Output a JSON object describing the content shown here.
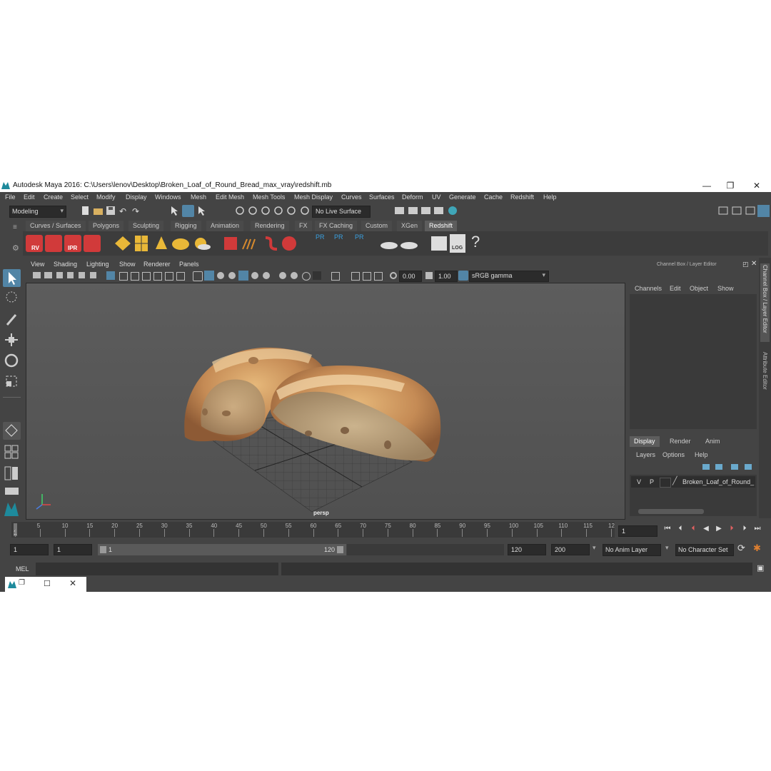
{
  "window": {
    "title": "Autodesk Maya 2016: C:\\Users\\lenov\\Desktop\\Broken_Loaf_of_Round_Bread_max_vray\\redshift.mb",
    "minimize": "—",
    "restore": "❐",
    "close": "✕"
  },
  "menubar": [
    "File",
    "Edit",
    "Create",
    "Select",
    "Modify",
    "Display",
    "Windows",
    "Mesh",
    "Edit Mesh",
    "Mesh Tools",
    "Mesh Display",
    "Curves",
    "Surfaces",
    "Deform",
    "UV",
    "Generate",
    "Cache",
    "Redshift",
    "Help"
  ],
  "statusline": {
    "mode": "Modeling",
    "live_surface": "No Live Surface"
  },
  "shelf": {
    "tabs": [
      "Curves / Surfaces",
      "Polygons",
      "Sculpting",
      "Rigging",
      "Animation",
      "Rendering",
      "FX",
      "FX Caching",
      "Custom",
      "XGen",
      "Redshift"
    ],
    "active_tab": "Redshift",
    "icon_labels": {
      "rv": "RV",
      "ipr": "IPR",
      "pr1": "PR",
      "pr2": "PR",
      "pr3": "PR",
      "log": "LOG",
      "help": "?"
    }
  },
  "viewport": {
    "menu": [
      "View",
      "Shading",
      "Lighting",
      "Show",
      "Renderer",
      "Panels"
    ],
    "exposure": "0.00",
    "gamma": "1.00",
    "color_space": "sRGB gamma",
    "camera_label": "persp"
  },
  "right_panel": {
    "header": "Channel Box / Layer Editor",
    "channel_menu": [
      "Channels",
      "Edit",
      "Object",
      "Show"
    ],
    "layer_tabs": [
      "Display",
      "Render",
      "Anim"
    ],
    "active_layer_tab": "Display",
    "layer_menu": [
      "Layers",
      "Options",
      "Help"
    ],
    "layer": {
      "v": "V",
      "p": "P",
      "name": "Broken_Loaf_of_Round_"
    },
    "vertical_tabs": [
      "Channel Box / Layer Editor",
      "Attribute Editor"
    ]
  },
  "timeline": {
    "ticks": [
      "1",
      "5",
      "10",
      "15",
      "20",
      "25",
      "30",
      "35",
      "40",
      "45",
      "50",
      "55",
      "60",
      "65",
      "70",
      "75",
      "80",
      "85",
      "90",
      "95",
      "100",
      "105",
      "110",
      "115",
      "12"
    ],
    "current_frame": "1"
  },
  "range": {
    "start": "1",
    "playback_start": "1",
    "range_start": "1",
    "range_end": "120",
    "playback_end": "120",
    "end": "200",
    "anim_layer": "No Anim Layer",
    "character_set": "No Character Set"
  },
  "command": {
    "mel_label": "MEL"
  },
  "colors": {
    "accent": "#5285a6",
    "bg": "#444444",
    "shelf_red": "#d13a3a"
  }
}
